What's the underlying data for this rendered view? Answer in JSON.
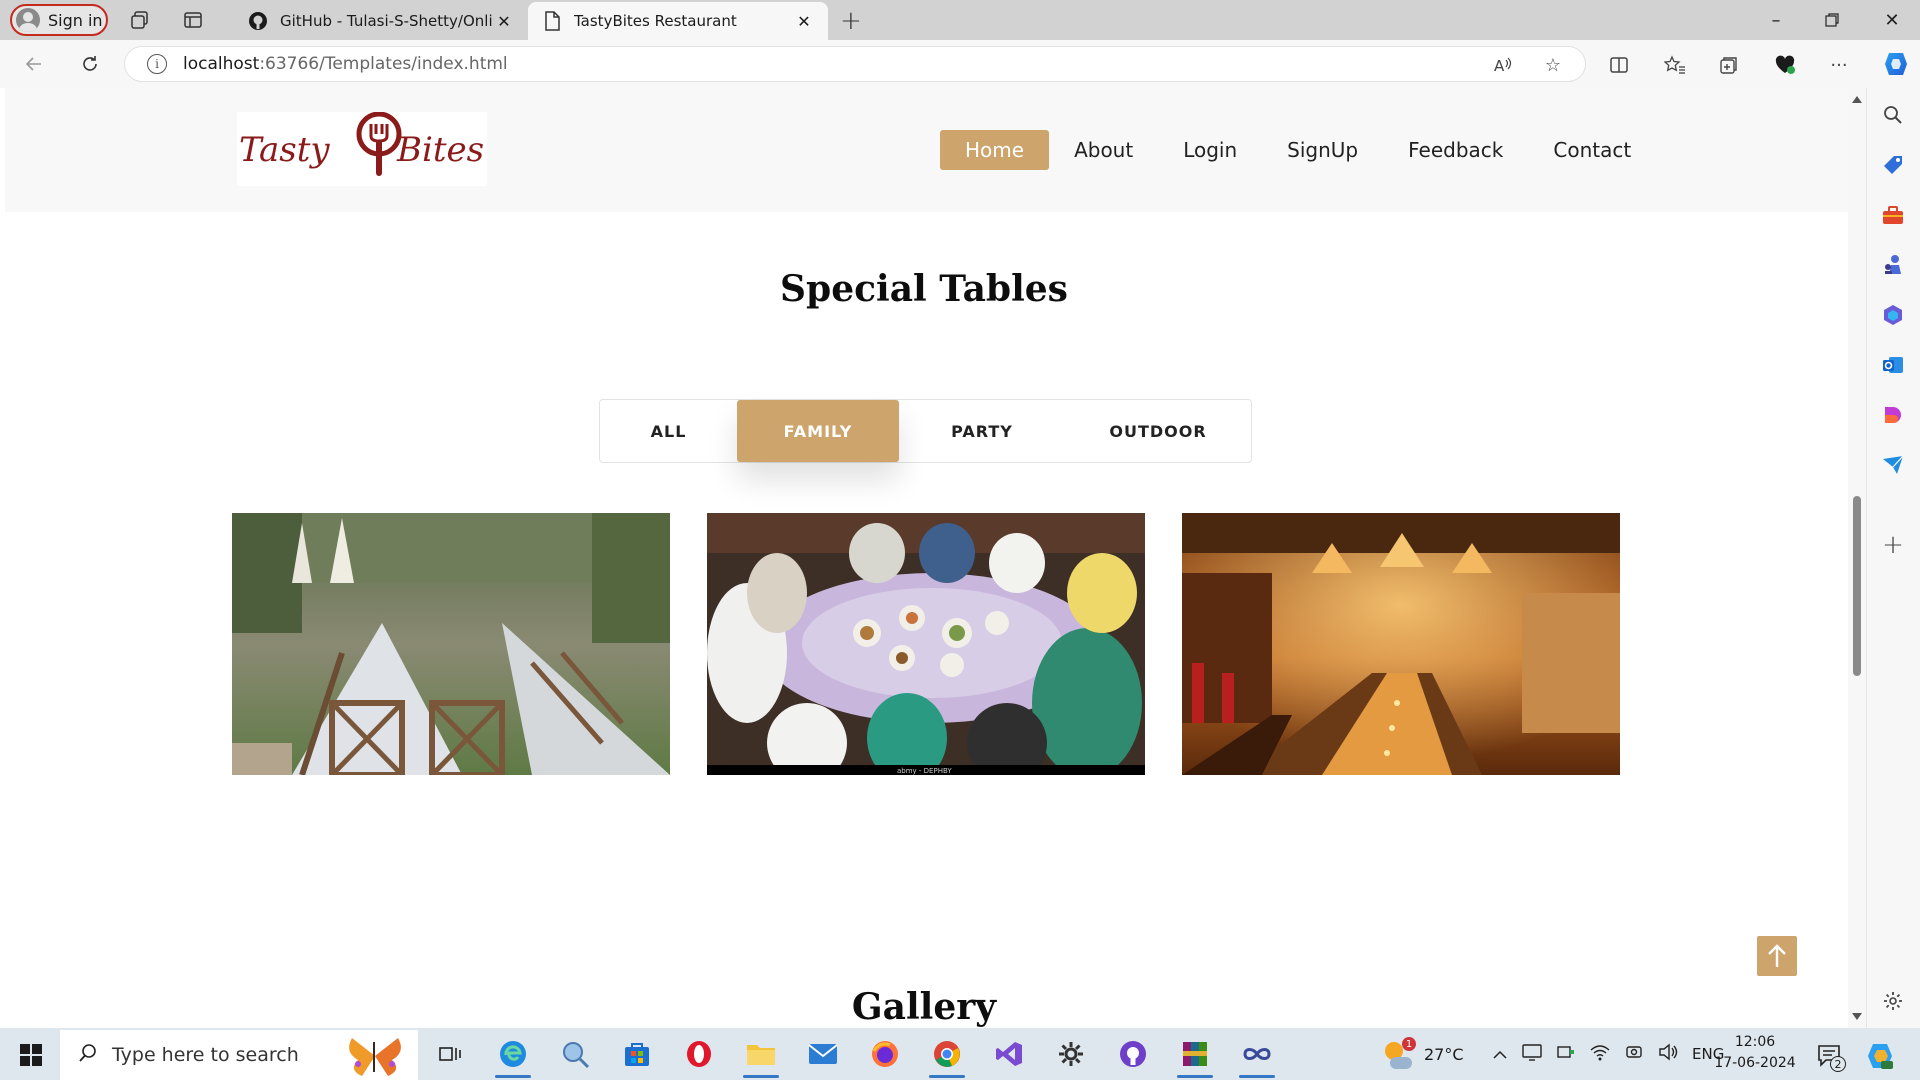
{
  "browser": {
    "profile_label": "Sign in",
    "tabs": [
      {
        "title": "GitHub - Tulasi-S-Shetty/Online-",
        "active": false
      },
      {
        "title": "TastyBites Restaurant",
        "active": true
      }
    ],
    "url_host": "localhost",
    "url_path": ":63766/Templates/index.html"
  },
  "site": {
    "logo_text_left": "Tasty",
    "logo_text_right": "Bites",
    "brand_color": "#cda46c",
    "logo_color": "#8b1a1a",
    "nav": [
      {
        "label": "Home",
        "active": true
      },
      {
        "label": "About",
        "active": false
      },
      {
        "label": "Login",
        "active": false
      },
      {
        "label": "SignUp",
        "active": false
      },
      {
        "label": "Feedback",
        "active": false
      },
      {
        "label": "Contact",
        "active": false
      }
    ]
  },
  "tables_section": {
    "title": "Special Tables",
    "filters": [
      {
        "label": "ALL",
        "active": false
      },
      {
        "label": "FAMILY",
        "active": true
      },
      {
        "label": "PARTY",
        "active": false
      },
      {
        "label": "OUTDOOR",
        "active": false
      }
    ],
    "images": [
      {
        "subject": "outdoor-wedding-long-table"
      },
      {
        "subject": "family-round-table-dinner"
      },
      {
        "subject": "restaurant-long-table-interior"
      }
    ]
  },
  "gallery_section": {
    "title": "Gallery"
  },
  "taskbar": {
    "search_placeholder": "Type here to search",
    "weather_temp": "27°C",
    "weather_badge": "1",
    "language": "ENG",
    "time": "12:06",
    "date": "17-06-2024",
    "notification_count": "2"
  }
}
